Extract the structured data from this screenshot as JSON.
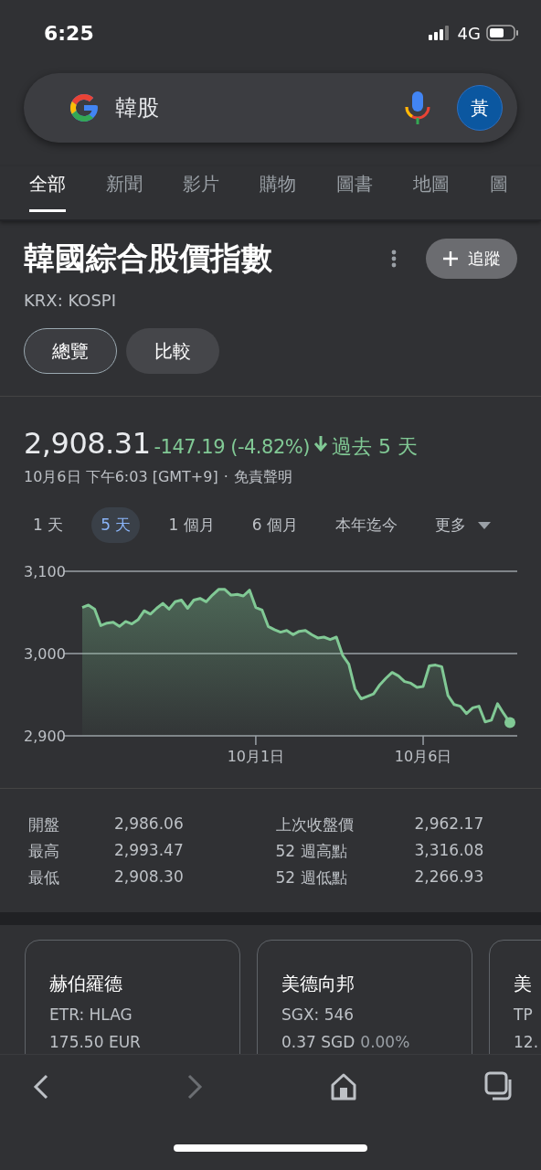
{
  "status_bar": {
    "time": "6:25",
    "network": "4G"
  },
  "search": {
    "query": "韓股",
    "avatar": "黃"
  },
  "tabs": [
    {
      "label": "全部",
      "selected": true
    },
    {
      "label": "新聞",
      "selected": false
    },
    {
      "label": "影片",
      "selected": false
    },
    {
      "label": "購物",
      "selected": false
    },
    {
      "label": "圖書",
      "selected": false
    },
    {
      "label": "地圖",
      "selected": false
    },
    {
      "label": "圖",
      "selected": false
    }
  ],
  "header": {
    "title": "韓國綜合股價指數",
    "ticker": "KRX: KOSPI",
    "follow_label": "追蹤"
  },
  "view_chips": [
    {
      "label": "總覽",
      "selected": true
    },
    {
      "label": "比較",
      "selected": false
    }
  ],
  "quote": {
    "price": "2,908.31",
    "change": "-147.19 (-4.82%)",
    "period": "過去 5 天",
    "timestamp": "10月6日 下午6:03 [GMT+9]",
    "separator": "·",
    "disclaimer": "免責聲明"
  },
  "ranges": [
    {
      "label": "1 天",
      "selected": false
    },
    {
      "label": "5 天",
      "selected": true
    },
    {
      "label": "1 個月",
      "selected": false
    },
    {
      "label": "6 個月",
      "selected": false
    },
    {
      "label": "本年迄今",
      "selected": false
    },
    {
      "label": "更多",
      "selected": false
    }
  ],
  "chart_data": {
    "type": "area",
    "categories": [
      null,
      null,
      null,
      null,
      null,
      null,
      null,
      null,
      null,
      null,
      null,
      null,
      null,
      null,
      null,
      null,
      null,
      null,
      null,
      null,
      null,
      null,
      null,
      null,
      null,
      null,
      null,
      null,
      "10月1日",
      null,
      null,
      null,
      null,
      null,
      null,
      null,
      null,
      null,
      null,
      null,
      null,
      null,
      null,
      null,
      null,
      null,
      null,
      null,
      null,
      null,
      null,
      null,
      null,
      null,
      null,
      "10月6日",
      null,
      null,
      null,
      null,
      null,
      null,
      null,
      null,
      null,
      null,
      null,
      null,
      null,
      null
    ],
    "series": [
      {
        "color": "#81c995",
        "values": [
          3056,
          3059,
          3054,
          3034,
          3037,
          3038,
          3033,
          3039,
          3036,
          3041,
          3052,
          3048,
          3055,
          3061,
          3054,
          3063,
          3065,
          3055,
          3065,
          3067,
          3063,
          3071,
          3078,
          3078,
          3071,
          3072,
          3070,
          3077,
          3056,
          3053,
          3033,
          3029,
          3026,
          3028,
          3023,
          3027,
          3028,
          3023,
          3019,
          3020,
          3017,
          3020,
          2998,
          2987,
          2957,
          2945,
          2948,
          2951,
          2962,
          2970,
          2977,
          2973,
          2966,
          2964,
          2959,
          2960,
          2985,
          2986,
          2984,
          2949,
          2938,
          2936,
          2927,
          2934,
          2936,
          2917,
          2919,
          2939,
          2927,
          2916
        ]
      }
    ],
    "ylim": [
      2900,
      3100
    ],
    "yticks": [
      {
        "value": 2900,
        "label": "2,900"
      },
      {
        "value": 3000,
        "label": "3,000"
      },
      {
        "value": 3100,
        "label": "3,100"
      }
    ]
  },
  "stats": [
    {
      "label": "開盤",
      "value": "2,986.06"
    },
    {
      "label": "上次收盤價",
      "value": "2,962.17"
    },
    {
      "label": "最高",
      "value": "2,993.47"
    },
    {
      "label": "52 週高點",
      "value": "3,316.08"
    },
    {
      "label": "最低",
      "value": "2,908.30"
    },
    {
      "label": "52 週低點",
      "value": "2,266.93"
    }
  ],
  "related": [
    {
      "name": "赫伯羅德",
      "ticker": "ETR: HLAG",
      "price": "175.50 EUR"
    },
    {
      "name": "美德向邦",
      "ticker": "SGX: 546",
      "price": "0.37 SGD",
      "change": "0.00%"
    },
    {
      "name": "美",
      "ticker": "TP",
      "price": "12."
    }
  ]
}
